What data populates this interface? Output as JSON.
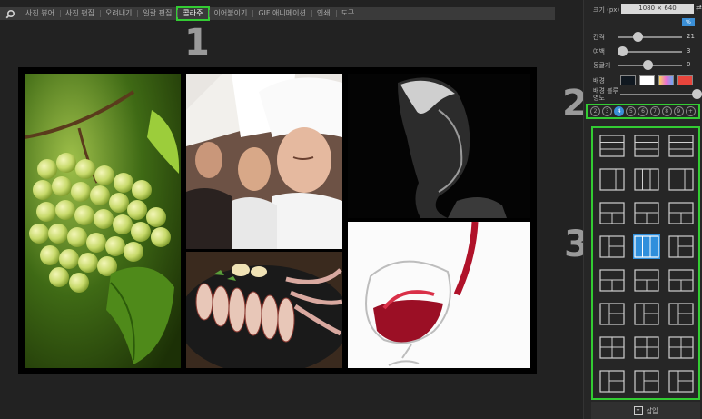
{
  "menu": {
    "tabs": [
      {
        "label": "사진 뷰어"
      },
      {
        "label": "사진 편집"
      },
      {
        "label": "오려내기"
      },
      {
        "label": "일괄 편집"
      },
      {
        "label": "콜라주",
        "active": true
      },
      {
        "label": "이어붙이기"
      },
      {
        "label": "GIF 애니메이션"
      },
      {
        "label": "인쇄"
      },
      {
        "label": "도구"
      }
    ],
    "active_color": "#33cc33"
  },
  "callouts": {
    "one": "1",
    "two": "2",
    "three": "3"
  },
  "panel": {
    "size_label": "크기 (px)",
    "size_value": "1080 × 640",
    "spacing_label": "간격",
    "spacing_value": "21",
    "spacing_level": 0.3,
    "margin_label": "여백",
    "margin_value": "3",
    "margin_level": 0.05,
    "round_label": "둥글기",
    "round_value": "0",
    "round_level": 0.45,
    "bg_label": "배경",
    "blur_label": "배경 블루영도",
    "blur_level": 0.98,
    "swatches": [
      "#101820",
      "#ffffff",
      "#c9a3e0",
      "#e8453c"
    ],
    "accent_color": "#3b8fd6"
  },
  "counts": {
    "items": [
      "2",
      "3",
      "4",
      "5",
      "6",
      "7",
      "8",
      "9",
      "+"
    ],
    "selected_index": 2
  },
  "templates": {
    "columns": 3,
    "rows": 8,
    "selected_index": 10
  },
  "insert_label": "삽입"
}
